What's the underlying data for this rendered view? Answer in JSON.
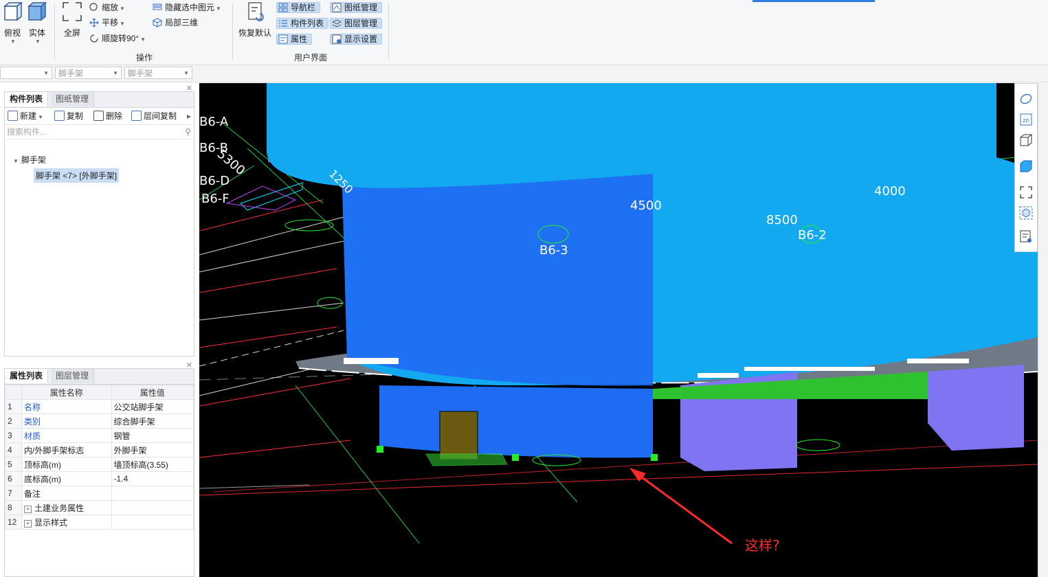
{
  "ribbon": {
    "view_top": "俯视",
    "view_solid": "实体",
    "fullscreen": "全屏",
    "zoom": "缩放",
    "pan": "平移",
    "rotate": "顺旋转90°",
    "hide_selected": "隐藏选中图元",
    "local_3d": "局部三维",
    "group_ops": "操作",
    "restore_default": "恢复默认",
    "nav_bar": "导航栏",
    "component_list": "构件列表",
    "properties": "属性",
    "drawing_mgmt": "图纸管理",
    "layer_mgmt": "图层管理",
    "display_settings": "显示设置",
    "group_ui": "用户界面"
  },
  "filters": {
    "combo2": "脚手架",
    "combo3": "脚手架"
  },
  "component_panel": {
    "tab_components": "构件列表",
    "tab_drawings": "图纸管理",
    "new": "新建",
    "copy": "复制",
    "delete": "删除",
    "floor_copy": "层间复制",
    "search_placeholder": "搜索构件...",
    "tree_root": "脚手架",
    "tree_item": "脚手架 <7> [外脚手架]"
  },
  "property_panel": {
    "tab_props": "属性列表",
    "tab_layers": "图层管理",
    "col_name": "属性名称",
    "col_value": "属性值",
    "rows": [
      {
        "no": "1",
        "name": "名称",
        "value": "公交站脚手架"
      },
      {
        "no": "2",
        "name": "类别",
        "value": "综合脚手架"
      },
      {
        "no": "3",
        "name": "材质",
        "value": "钢管"
      },
      {
        "no": "4",
        "name": "内/外脚手架标志",
        "value": "外脚手架"
      },
      {
        "no": "5",
        "name": "顶标高(m)",
        "value": "墙顶标高(3.55)"
      },
      {
        "no": "6",
        "name": "底标高(m)",
        "value": "-1.4"
      },
      {
        "no": "7",
        "name": "备注",
        "value": ""
      },
      {
        "no": "8",
        "name": "土建业务属性",
        "value": ""
      },
      {
        "no": "12",
        "name": "显示样式",
        "value": ""
      }
    ]
  },
  "viewport": {
    "axis_labels": [
      "B6-A",
      "B6-B",
      "B6-D",
      "B6-F",
      "B6-3",
      "B6-2"
    ],
    "dims": [
      "5300",
      "1250",
      "4500",
      "4000",
      "8500"
    ],
    "annotation": "这样?"
  },
  "colors": {
    "main_cylinder": "#12a9f0",
    "scaffold_blue": "#1e6cf2",
    "purple_block": "#7f74f2",
    "green_slab": "#2ec231",
    "annotation_red": "#ff2a2a"
  }
}
